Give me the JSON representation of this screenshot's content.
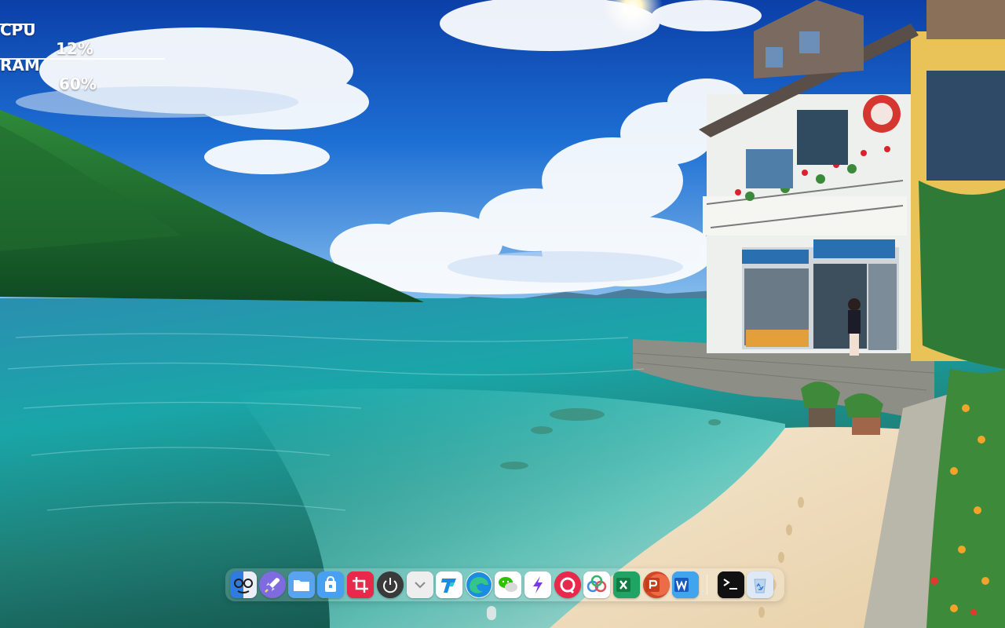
{
  "system_monitor": {
    "cpu_label": "CPU",
    "cpu_value": "12%",
    "ram_label": "RAM",
    "ram_value": "60%"
  },
  "dock": {
    "apps": [
      {
        "icon": "finder-face-icon",
        "color": "#2f7be0"
      },
      {
        "icon": "rocket-launcher-icon",
        "color": "#7f6be0"
      },
      {
        "icon": "folder-icon",
        "color": "#5aa4ef"
      },
      {
        "icon": "app-store-bag-icon",
        "color": "#4aa0f0"
      },
      {
        "icon": "crop-tool-icon",
        "color": "#e8294c"
      },
      {
        "icon": "power-icon",
        "color": "#3a3a3a"
      },
      {
        "icon": "chevron-down-icon",
        "color": "#eeeeee"
      },
      {
        "icon": "feishu-t-icon",
        "color": "#ffffff"
      },
      {
        "icon": "edge-browser-icon",
        "color": "#1b8de0"
      },
      {
        "icon": "wechat-icon",
        "color": "#ffffff"
      },
      {
        "icon": "lightning-app-icon",
        "color": "#ffffff"
      },
      {
        "icon": "ring-app-icon",
        "color": "#e8294c"
      },
      {
        "icon": "cloud-drive-icon",
        "color": "#ffffff"
      },
      {
        "icon": "excel-icon",
        "color": "#1d7a44"
      },
      {
        "icon": "powerpoint-icon",
        "color": "#d24726"
      },
      {
        "icon": "word-icon",
        "color": "#2b5fb8"
      },
      {
        "icon": "terminal-icon",
        "color": "#111111"
      },
      {
        "icon": "recycle-bin-icon",
        "color": "#dfe9f5"
      }
    ]
  }
}
